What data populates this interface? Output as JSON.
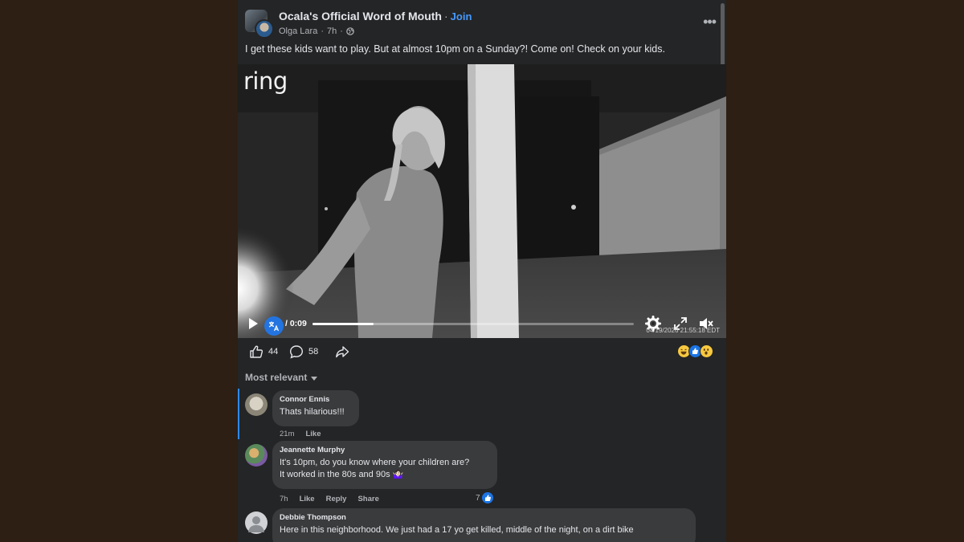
{
  "post": {
    "group_name": "Ocala's Official Word of Mouth",
    "join_label": "Join",
    "author": "Olga Lara",
    "time": "7h",
    "text": "I get these kids want to play. But at almost 10pm on a Sunday?! Come on! Check on your kids."
  },
  "video": {
    "brand": "ring",
    "time_label": "/ 0:09",
    "timestamp": "04/19/2026 21:55:18 EDT",
    "progress": 0.19
  },
  "actions": {
    "likes": "44",
    "comments": "58"
  },
  "sort_label": "Most relevant",
  "comments": [
    {
      "name": "Connor Ennis",
      "text": "Thats hilarious!!!",
      "time": "21m",
      "like_label": "Like"
    },
    {
      "name": "Jeannette Murphy",
      "line1": "It's 10pm, do you know where your children are?",
      "line2": "It worked in the 80s and 90s 🤷🏻‍♀️",
      "time": "7h",
      "like_label": "Like",
      "reply_label": "Reply",
      "share_label": "Share",
      "reaction_count": "7"
    },
    {
      "name": "Debbie Thompson",
      "text": "Here in this neighborhood. We just had a 17 yo get killed, middle of the night, on a dirt bike"
    }
  ],
  "colors": {
    "panel_bg": "#242526",
    "page_bg": "#2d1f14",
    "accent_blue": "#2374e1",
    "bubble_bg": "#3a3b3c"
  }
}
